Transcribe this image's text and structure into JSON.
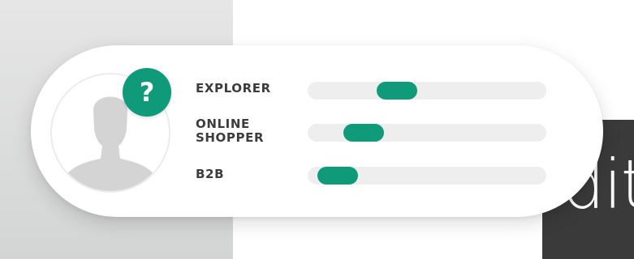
{
  "badge": {
    "symbol": "?"
  },
  "background_text": "dit",
  "personas": [
    {
      "label_lines": [
        "EXPLORER"
      ],
      "level": 0.35
    },
    {
      "label_lines": [
        "ONLINE",
        "SHOPPER"
      ],
      "level": 0.18
    },
    {
      "label_lines": [
        "B2B"
      ],
      "level": 0.05
    }
  ],
  "colors": {
    "accent": "#0f9a7a",
    "track": "#eeeeee",
    "label": "#3c3c3c",
    "avatar": "#d4d4d4"
  },
  "icons": {
    "avatar": "person-silhouette-icon",
    "badge": "question-mark-icon"
  }
}
